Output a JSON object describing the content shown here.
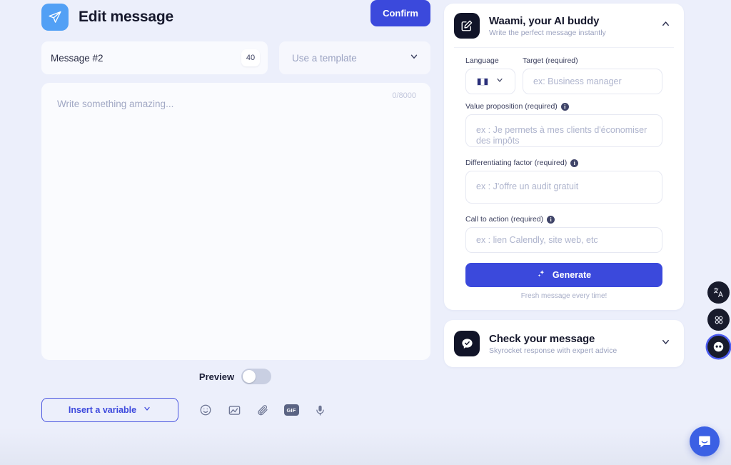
{
  "header": {
    "title": "Edit message",
    "icon": "send-icon"
  },
  "message_meta": {
    "name": "Message #2",
    "count_badge": "40",
    "template_placeholder": "Use a template"
  },
  "editor": {
    "placeholder": "Write something amazing...",
    "counter": "0/8000"
  },
  "preview": {
    "label": "Preview",
    "enabled": false
  },
  "toolbar": {
    "insert_variable_label": "Insert a variable",
    "icons": [
      {
        "name": "emoji-icon",
        "label": "Emoji"
      },
      {
        "name": "image-icon",
        "label": "Image"
      },
      {
        "name": "attachment-icon",
        "label": "Attachment"
      },
      {
        "name": "gif-icon",
        "label": "GIF"
      },
      {
        "name": "microphone-icon",
        "label": "Voice note"
      }
    ],
    "confirm_label": "Confirm"
  },
  "ai_panel": {
    "title": "Waami, your AI buddy",
    "subtitle": "Write the perfect message instantly",
    "icon": "compose-icon",
    "expanded": true,
    "fields": {
      "language_label": "Language",
      "language_value": "fr",
      "target_label": "Target (required)",
      "target_placeholder": "ex: Business manager",
      "value_prop_label": "Value proposition (required)",
      "value_prop_placeholder": "ex : Je permets à mes clients d'économiser des impôts",
      "diff_factor_label": "Differentiating factor (required)",
      "diff_factor_placeholder": "ex : J'offre un audit gratuit",
      "cta_label": "Call to action (required)",
      "cta_placeholder": "ex : lien Calendly, site web, etc"
    },
    "generate_label": "Generate",
    "generate_caption": "Fresh message every time!"
  },
  "check_panel": {
    "title": "Check your message",
    "subtitle": "Skyrocket response with expert advice",
    "icon": "chat-check-icon",
    "expanded": false
  },
  "rail": [
    {
      "name": "translate-icon"
    },
    {
      "name": "apps-grid-icon"
    },
    {
      "name": "assistant-icon"
    }
  ],
  "colors": {
    "accent": "#3b49dc",
    "page_bg": "#eceffb",
    "dark": "#111428"
  }
}
